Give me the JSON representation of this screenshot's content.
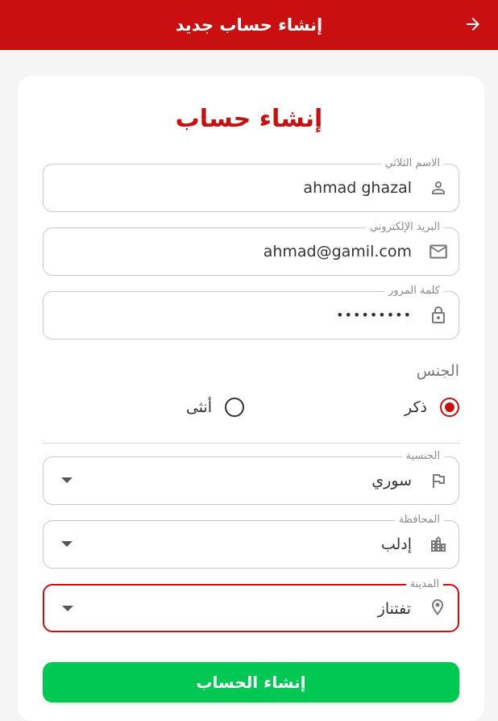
{
  "appbar": {
    "title": "إنشاء حساب جديد",
    "back_icon": "arrow-forward-icon"
  },
  "form": {
    "title": "إنشاء حساب",
    "full_name": {
      "label": "الاسم الثلاثي",
      "value": "ahmad ghazal",
      "icon": "person-icon"
    },
    "email": {
      "label": "البريد الإلكتروني",
      "value": "ahmad@gamil.com",
      "icon": "mail-icon"
    },
    "password": {
      "label": "كلمة المرور",
      "value": "•••••••••",
      "icon": "lock-icon"
    },
    "gender": {
      "label": "الجنس",
      "options": [
        {
          "label": "ذكر",
          "selected": true
        },
        {
          "label": "أنثى",
          "selected": false
        }
      ]
    },
    "nationality": {
      "label": "الجنسية",
      "value": "سوري",
      "icon": "flag-icon"
    },
    "governorate": {
      "label": "المحافظة",
      "value": "إدلب",
      "icon": "city-icon"
    },
    "city": {
      "label": "المدينة",
      "value": "تفتناز",
      "icon": "location-pin-icon"
    },
    "submit_label": "إنشاء الحساب"
  },
  "colors": {
    "primary": "#c90f0f",
    "submit": "#00c853"
  }
}
